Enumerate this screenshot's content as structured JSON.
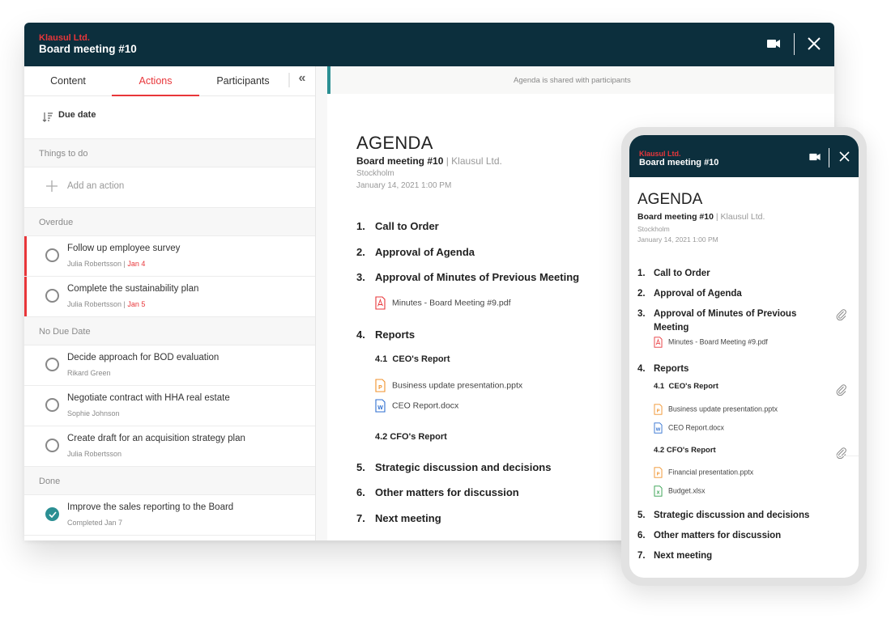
{
  "window": {
    "org": "Klausul Ltd.",
    "title": "Board meeting #10",
    "icons": {
      "video": "video-camera-icon",
      "close": "close-icon"
    }
  },
  "left_panel": {
    "tabs": [
      {
        "label": "Content",
        "active": false
      },
      {
        "label": "Actions",
        "active": true
      },
      {
        "label": "Participants",
        "active": false
      }
    ],
    "collapse_icon": "double-chevron-left-icon",
    "sort": {
      "label": "Due date",
      "icon": "sort-descending-icon"
    },
    "sections": {
      "todo": "Things to do",
      "overdue": "Overdue",
      "no_due": "No Due Date",
      "done": "Done"
    },
    "add_action": "Add an action",
    "overdue_actions": [
      {
        "title": "Follow up employee survey",
        "assignee": "Julia Robertsson",
        "date": "Jan 4"
      },
      {
        "title": "Complete the sustainability plan",
        "assignee": "Julia Robertsson",
        "date": "Jan 5"
      }
    ],
    "no_due_actions": [
      {
        "title": "Decide approach for BOD evaluation",
        "assignee": "Rikard Green"
      },
      {
        "title": "Negotiate contract with HHA real estate",
        "assignee": "Sophie Johnson"
      },
      {
        "title": "Create draft for an acquisition strategy plan",
        "assignee": "Julia Robertsson"
      }
    ],
    "done_actions": [
      {
        "title": "Improve the sales reporting to the Board",
        "meta": "Completed Jan 7"
      }
    ]
  },
  "agenda": {
    "banner": "Agenda is shared with participants",
    "heading": "AGENDA",
    "meeting": "Board meeting #10",
    "separator": " | ",
    "org": "Klausul Ltd.",
    "location": "Stockholm",
    "datetime": "January 14, 2021 1:00 PM",
    "items": [
      {
        "num": "1.",
        "title": "Call to Order"
      },
      {
        "num": "2.",
        "title": "Approval of Agenda"
      },
      {
        "num": "3.",
        "title": "Approval of Minutes of Previous Meeting"
      },
      {
        "num": "4.",
        "title": "Reports"
      },
      {
        "num": "5.",
        "title": "Strategic discussion and decisions"
      },
      {
        "num": "6.",
        "title": "Other matters for discussion"
      },
      {
        "num": "7.",
        "title": "Next meeting"
      }
    ],
    "subitems": [
      {
        "num": "4.1",
        "title": "CEO's Report"
      },
      {
        "num": "4.2",
        "title": "CFO's Report"
      }
    ],
    "files": {
      "minutes": {
        "name": "Minutes - Board Meeting #9.pdf",
        "type": "pdf",
        "color": "#e8363a"
      },
      "business": {
        "name": "Business update presentation.pptx",
        "type": "pptx",
        "color": "#f0922b"
      },
      "ceo_report": {
        "name": "CEO Report.docx",
        "type": "docx",
        "color": "#2f6fd0"
      },
      "financial": {
        "name": "Financial presentation.pptx",
        "type": "pptx",
        "color": "#f0922b"
      },
      "budget": {
        "name": "Budget.xlsx",
        "type": "xlsx",
        "color": "#2e9d4a"
      }
    },
    "file_letters": {
      "pptx": "P",
      "docx": "W",
      "xlsx": "X"
    }
  },
  "mobile": {
    "org": "Klausul Ltd.",
    "title": "Board meeting #10",
    "attachment_icon": "paperclip-icon"
  },
  "colors": {
    "header_bg": "#0c2f3d",
    "accent_red": "#e8363a",
    "teal": "#2b8f93"
  }
}
